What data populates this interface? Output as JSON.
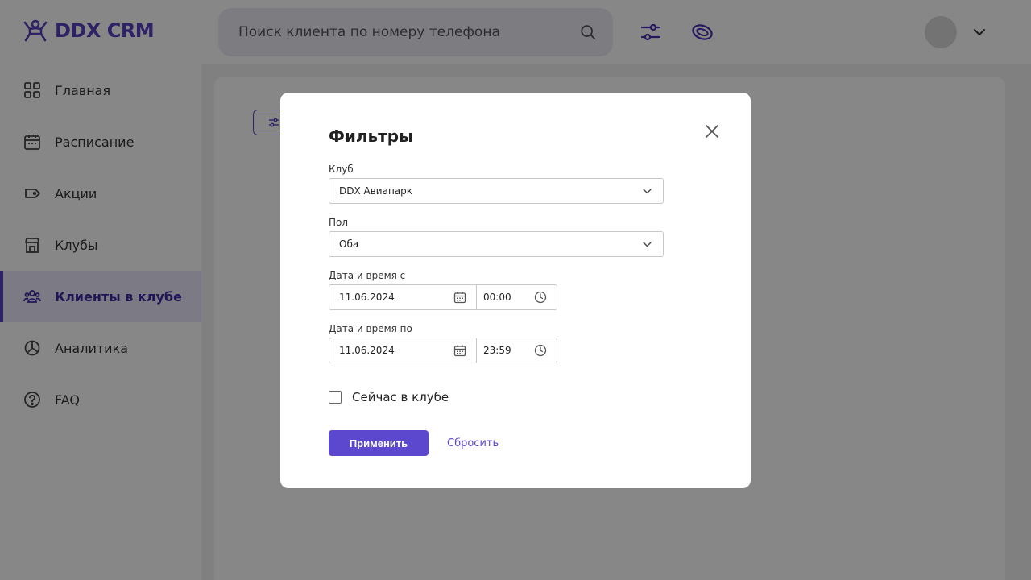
{
  "app": {
    "logo_text": "DDX CRM"
  },
  "header": {
    "search_placeholder": "Поиск клиента по номеру телефона"
  },
  "sidebar": {
    "items": [
      {
        "label": "Главная",
        "icon": "grid-icon"
      },
      {
        "label": "Расписание",
        "icon": "calendar-icon"
      },
      {
        "label": "Акции",
        "icon": "tag-icon"
      },
      {
        "label": "Клубы",
        "icon": "store-icon"
      },
      {
        "label": "Клиенты в клубе",
        "icon": "users-icon",
        "active": true
      },
      {
        "label": "Аналитика",
        "icon": "pie-chart-icon"
      },
      {
        "label": "FAQ",
        "icon": "help-circle-icon"
      }
    ]
  },
  "modal": {
    "title": "Фильтры",
    "club_label": "Клуб",
    "club_value": "DDX Авиапарк",
    "gender_label": "Пол",
    "gender_value": "Оба",
    "from_label": "Дата и время с",
    "from_date": "11.06.2024",
    "from_time": "00:00",
    "to_label": "Дата и время по",
    "to_date": "11.06.2024",
    "to_time": "23:59",
    "in_club_label": "Сейчас в клубе",
    "in_club_checked": false,
    "apply_label": "Применить",
    "reset_label": "Сбросить"
  },
  "colors": {
    "accent": "#5b48cf",
    "brand": "#5a3fc0",
    "overlay": "rgba(0,0,0,0.47)"
  }
}
